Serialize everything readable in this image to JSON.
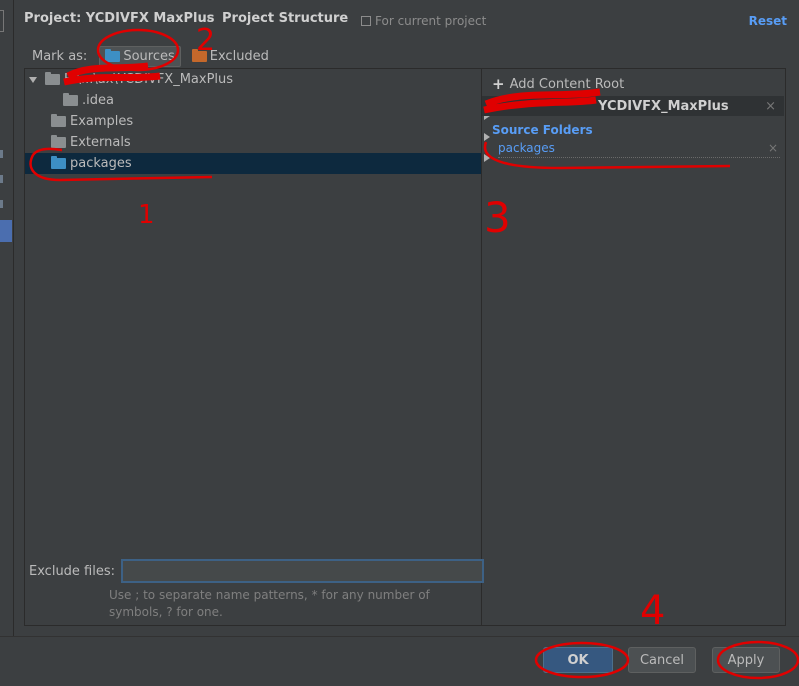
{
  "header": {
    "project": "Project: YCDIVFX MaxPlus",
    "separator": "›",
    "section": "Project Structure",
    "scope": "For current project",
    "reset": "Reset"
  },
  "mark_as": {
    "label": "Mark as:",
    "sources": "Sources",
    "excluded": "Excluded"
  },
  "tree": {
    "root_label": "E:\\...\\ax\\YCDIVFX_MaxPlus",
    "items": [
      {
        "label": ".idea"
      },
      {
        "label": "Examples"
      },
      {
        "label": "Externals"
      },
      {
        "label": "packages"
      }
    ]
  },
  "content_root": {
    "add_label": "Add Content Root",
    "root_name": "YCDIVFX_MaxPlus",
    "source_folders_title": "Source Folders",
    "source_folder": "packages",
    "close_glyph": "×"
  },
  "exclude": {
    "label": "Exclude files:",
    "value": "",
    "hint": "Use ; to separate name patterns, * for any number of symbols, ? for one."
  },
  "footer": {
    "ok": "OK",
    "cancel": "Cancel",
    "apply": "Apply"
  },
  "annotations": [
    "1",
    "2",
    "3",
    "4"
  ],
  "colors": {
    "bg": "#3c3f41",
    "accent": "#589df6",
    "selected_row": "#0d293e",
    "source_folder_icon": "#3d8fc4",
    "excluded_folder_icon": "#c4682b",
    "annotation": "#e00000"
  }
}
